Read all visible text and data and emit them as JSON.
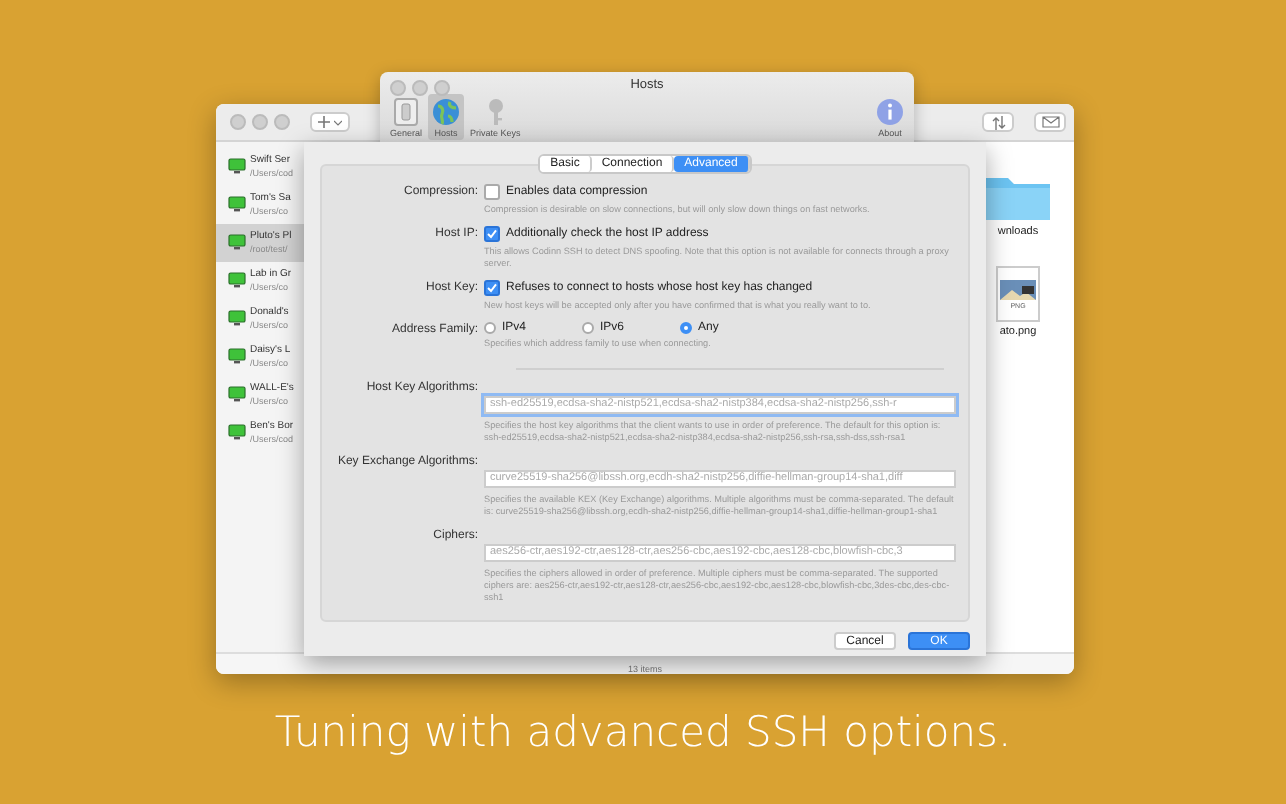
{
  "back_window": {
    "sidebar": {
      "items": [
        {
          "name": "Swift Ser",
          "path": "/Users/cod",
          "selected": false
        },
        {
          "name": "Tom's Sa",
          "path": "/Users/co",
          "selected": false
        },
        {
          "name": "Pluto's Pl",
          "path": "/root/test/",
          "selected": true
        },
        {
          "name": "Lab in Gr",
          "path": "/Users/co",
          "selected": false
        },
        {
          "name": "Donald's",
          "path": "/Users/co",
          "selected": false
        },
        {
          "name": "Daisy's L",
          "path": "/Users/co",
          "selected": false
        },
        {
          "name": "WALL-E's",
          "path": "/Users/co",
          "selected": false
        },
        {
          "name": "Ben's Bor",
          "path": "/Users/cod",
          "selected": false
        }
      ]
    },
    "files": [
      {
        "kind": "folder",
        "name": "wnloads"
      },
      {
        "kind": "image",
        "name": "ato.png",
        "badge": "PNG"
      }
    ],
    "status": "13 items"
  },
  "prefs_window": {
    "title": "Hosts",
    "toolbar": [
      {
        "label": "General",
        "kind": "general",
        "selected": false
      },
      {
        "label": "Hosts",
        "kind": "globe",
        "selected": true
      },
      {
        "label": "Private Keys",
        "kind": "key",
        "selected": false
      },
      {
        "label": "About",
        "kind": "info",
        "selected": false
      }
    ]
  },
  "sheet": {
    "tabs": [
      {
        "label": "Basic",
        "selected": false
      },
      {
        "label": "Connection",
        "selected": false
      },
      {
        "label": "Advanced",
        "selected": true
      }
    ],
    "rows": [
      {
        "kind": "checkbox",
        "label": "Compression:",
        "text": "Enables data compression",
        "checked": false,
        "hint": "Compression is desirable on slow connections, but will only slow down things on fast networks."
      },
      {
        "kind": "checkbox",
        "label": "Host IP:",
        "text": "Additionally check the host IP address",
        "checked": true,
        "hint": "This allows Codinn SSH to detect DNS spoofing. Note that this option is not available for connects through a proxy server."
      },
      {
        "kind": "checkbox",
        "label": "Host Key:",
        "text": "Refuses to connect to hosts whose host key has changed",
        "checked": true,
        "hint": "New host keys will be accepted only after you have confirmed that is what you really want to to."
      },
      {
        "kind": "radio",
        "label": "Address Family:",
        "options": [
          {
            "label": "IPv4",
            "selected": false
          },
          {
            "label": "IPv6",
            "selected": false
          },
          {
            "label": "Any",
            "selected": true
          }
        ],
        "hint": "Specifies which address family to use when connecting."
      },
      {
        "kind": "divider"
      },
      {
        "kind": "field",
        "label": "Host Key Algorithms:",
        "placeholder": "ssh-ed25519,ecdsa-sha2-nistp521,ecdsa-sha2-nistp384,ecdsa-sha2-nistp256,ssh-r",
        "focused": true,
        "hint": "Specifies the host key algorithms that the client wants to use in order of preference. The default for this option is: ssh-ed25519,ecdsa-sha2-nistp521,ecdsa-sha2-nistp384,ecdsa-sha2-nistp256,ssh-rsa,ssh-dss,ssh-rsa1"
      },
      {
        "kind": "field",
        "label": "Key Exchange Algorithms:",
        "placeholder": "curve25519-sha256@libssh.org,ecdh-sha2-nistp256,diffie-hellman-group14-sha1,diff",
        "focused": false,
        "hint": "Specifies the available KEX (Key Exchange) algorithms. Multiple algorithms must be comma-separated. The default is: curve25519-sha256@libssh.org,ecdh-sha2-nistp256,diffie-hellman-group14-sha1,diffie-hellman-group1-sha1"
      },
      {
        "kind": "field",
        "label": "Ciphers:",
        "placeholder": "aes256-ctr,aes192-ctr,aes128-ctr,aes256-cbc,aes192-cbc,aes128-cbc,blowfish-cbc,3",
        "focused": false,
        "hint": "Specifies the ciphers allowed in order of preference. Multiple ciphers must be comma-separated. The supported ciphers are: aes256-ctr,aes192-ctr,aes128-ctr,aes256-cbc,aes192-cbc,aes128-cbc,blowfish-cbc,3des-cbc,des-cbc-ssh1"
      }
    ],
    "buttons": [
      {
        "label": "Cancel",
        "kind": "secondary"
      },
      {
        "label": "OK",
        "kind": "primary"
      }
    ]
  },
  "caption": "Tuning with advanced SSH options."
}
